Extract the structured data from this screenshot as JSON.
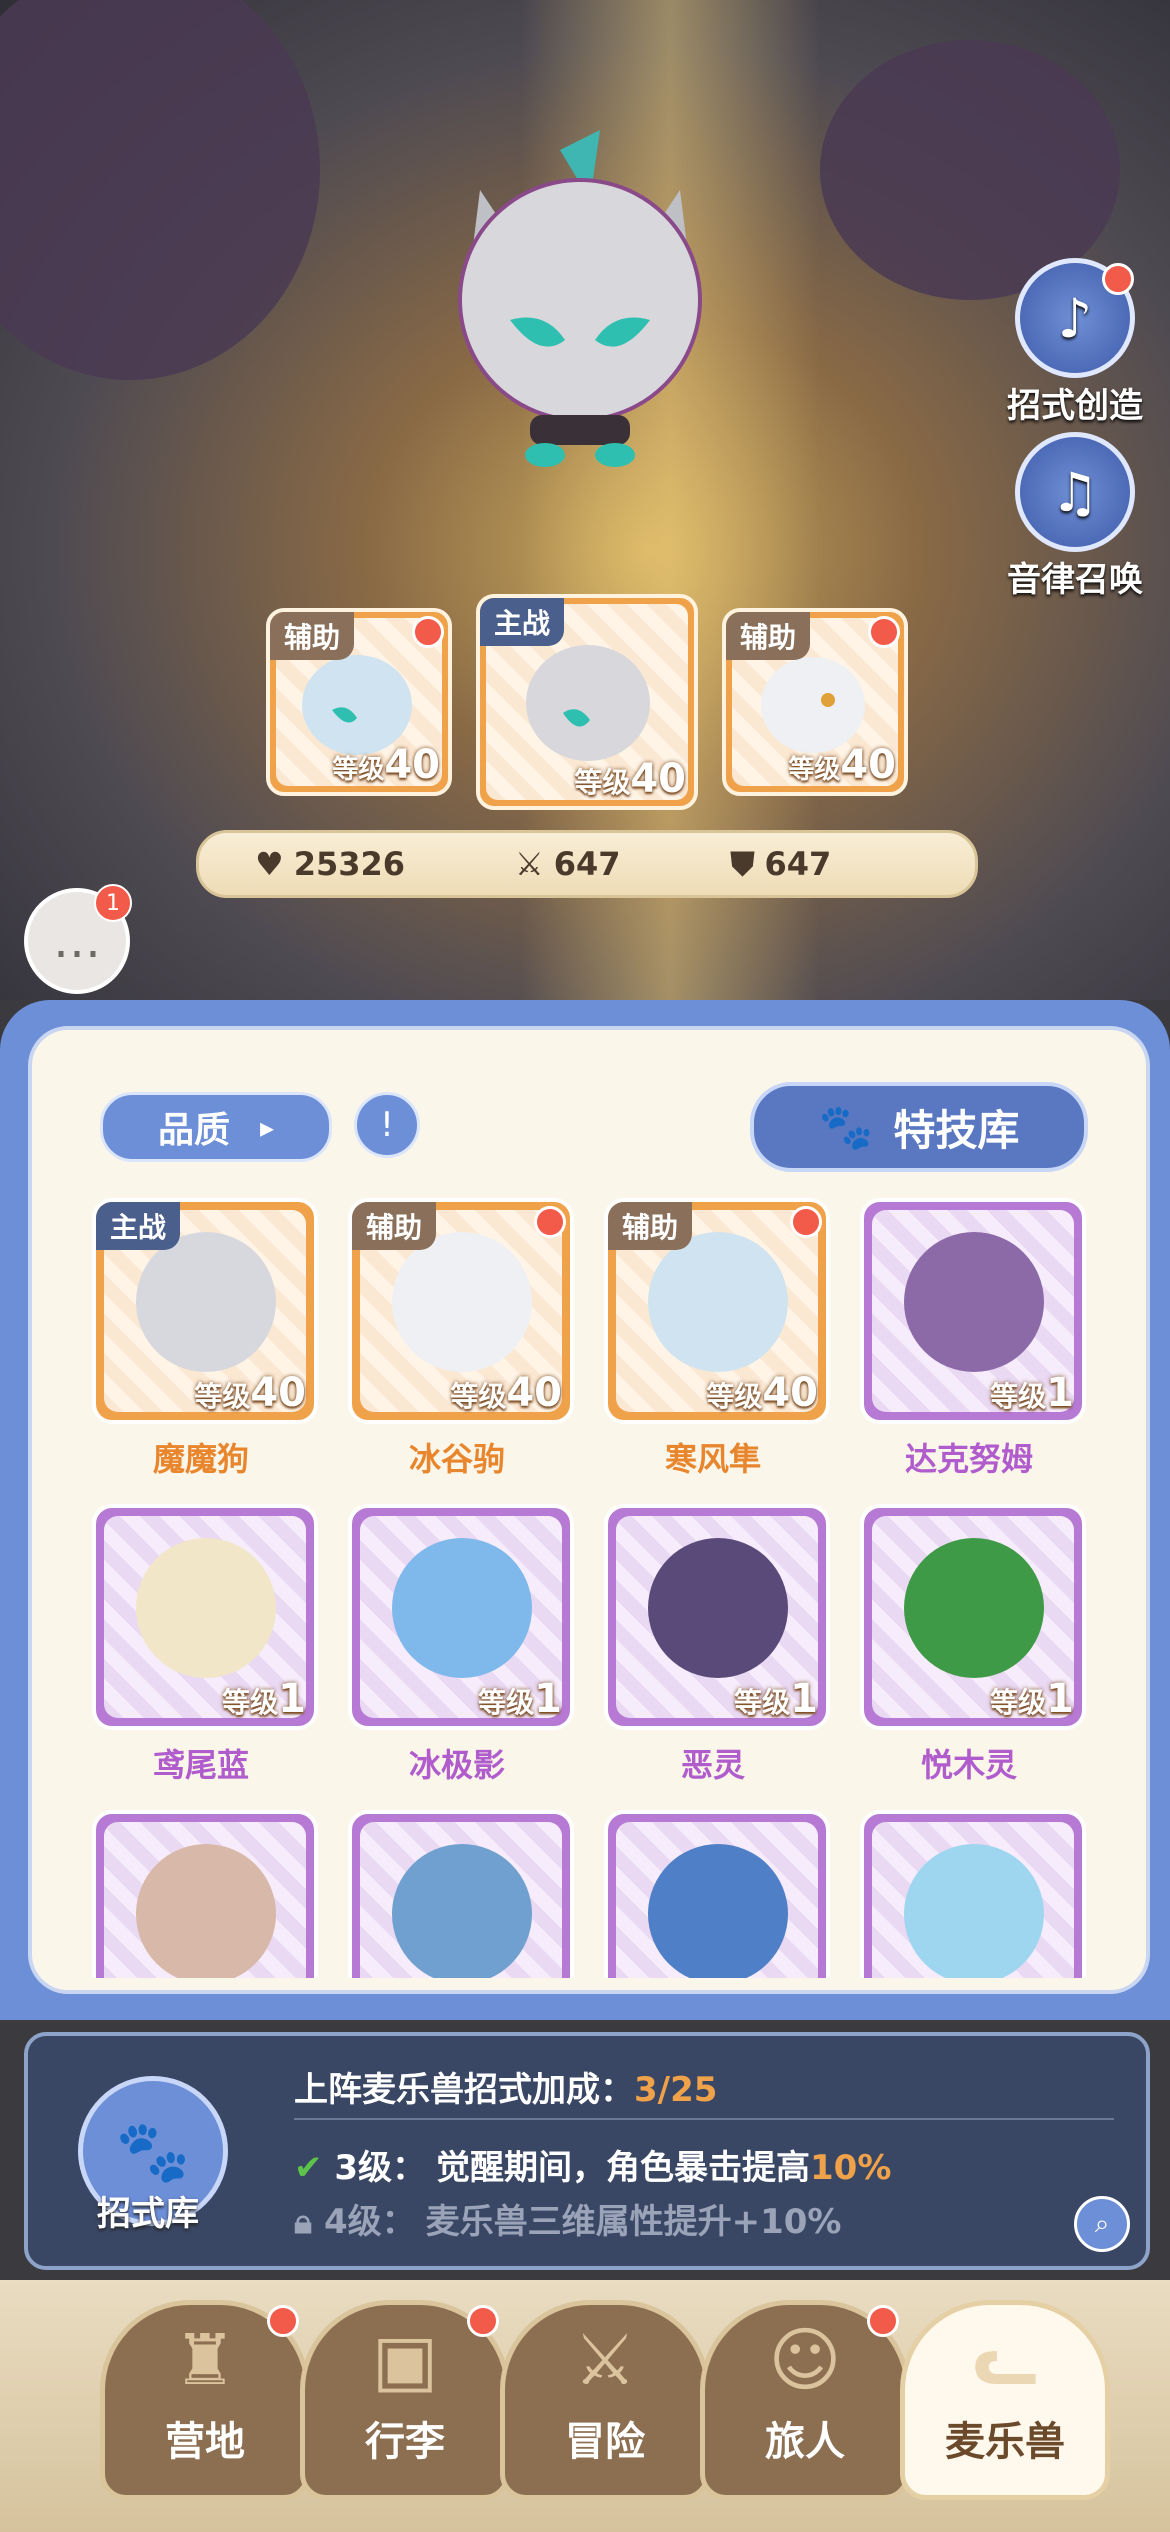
{
  "side_buttons": [
    {
      "label": "招式创造",
      "icon": "skill-create-icon"
    },
    {
      "label": "音律召唤",
      "icon": "lyre-icon"
    }
  ],
  "team": [
    {
      "role": "辅助",
      "level_prefix": "等级",
      "level": "40"
    },
    {
      "role": "主战",
      "level_prefix": "等级",
      "level": "40"
    },
    {
      "role": "辅助",
      "level_prefix": "等级",
      "level": "40"
    }
  ],
  "stats": {
    "hp": "25326",
    "attack": "647",
    "defense": "647"
  },
  "chat": {
    "badge": "1"
  },
  "panel": {
    "quality_label": "品质",
    "filter_icon": "!",
    "skill_library_label": "特技库"
  },
  "creatures": [
    {
      "name": "魔魔狗",
      "role": "主战",
      "level_prefix": "等级",
      "level": "40",
      "rarity": "orange",
      "color": "#d6d8dd"
    },
    {
      "name": "冰谷驹",
      "role": "辅助",
      "level_prefix": "等级",
      "level": "40",
      "rarity": "orange",
      "color": "#eef0f4"
    },
    {
      "name": "寒风隼",
      "role": "辅助",
      "level_prefix": "等级",
      "level": "40",
      "rarity": "orange",
      "color": "#cfe4f0"
    },
    {
      "name": "达克努姆",
      "role": "",
      "level_prefix": "等级",
      "level": "1",
      "rarity": "purple",
      "color": "#8c6aa8"
    },
    {
      "name": "鸢尾蓝",
      "role": "",
      "level_prefix": "等级",
      "level": "1",
      "rarity": "purple",
      "color": "#f2e6c8"
    },
    {
      "name": "冰极影",
      "role": "",
      "level_prefix": "等级",
      "level": "1",
      "rarity": "purple",
      "color": "#7fb8ea"
    },
    {
      "name": "恶灵",
      "role": "",
      "level_prefix": "等级",
      "level": "1",
      "rarity": "purple",
      "color": "#5a4a7a"
    },
    {
      "name": "悦木灵",
      "role": "",
      "level_prefix": "等级",
      "level": "1",
      "rarity": "purple",
      "color": "#3f9a48"
    },
    {
      "name": "",
      "role": "",
      "level_prefix": "",
      "level": "",
      "rarity": "purple",
      "color": "#d8b8a8"
    },
    {
      "name": "",
      "role": "",
      "level_prefix": "",
      "level": "",
      "rarity": "purple",
      "color": "#6fa0cf"
    },
    {
      "name": "",
      "role": "",
      "level_prefix": "",
      "level": "",
      "rarity": "purple",
      "color": "#4f7fc7"
    },
    {
      "name": "",
      "role": "",
      "level_prefix": "",
      "level": "",
      "rarity": "purple",
      "color": "#9fd6ef"
    }
  ],
  "bonus": {
    "icon_label": "招式库",
    "title": "上阵麦乐兽招式加成：",
    "progress": "3/25",
    "line1_level": "3级：",
    "line1_text": "觉醒期间，角色暴击提高",
    "line1_value": "10%",
    "line2_level": "4级：",
    "line2_text": "麦乐兽三维属性提升+10%"
  },
  "nav": [
    {
      "label": "营地",
      "icon": "castle-icon",
      "badge": true
    },
    {
      "label": "行李",
      "icon": "backpack-icon",
      "badge": true
    },
    {
      "label": "冒险",
      "icon": "crossed-swords-icon",
      "badge": false
    },
    {
      "label": "旅人",
      "icon": "traveler-icon",
      "badge": true
    },
    {
      "label": "麦乐兽",
      "icon": "cat-pet-icon",
      "badge": false,
      "active": true
    }
  ],
  "colors": {
    "accent_blue": "#6d8fd8",
    "orange_rarity": "#f0a24a",
    "purple_rarity": "#b67ad4",
    "badge_red": "#f25a4a",
    "highlight_orange": "#f0a24a"
  }
}
